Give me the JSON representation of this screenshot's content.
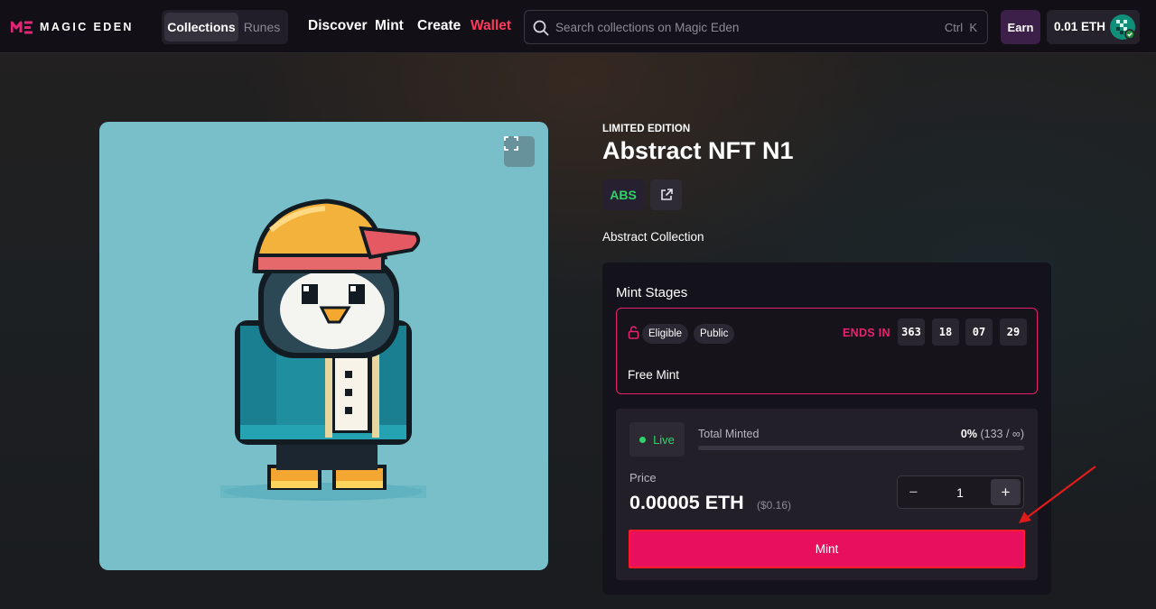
{
  "nav": {
    "logo_text": "MAGIC EDEN",
    "segments": [
      {
        "label": "Collections",
        "active": true
      },
      {
        "label": "Runes",
        "active": false
      }
    ],
    "links": [
      "Discover",
      "Mint",
      "Create",
      "Wallet"
    ],
    "search": {
      "placeholder": "Search collections on Magic Eden",
      "shortcut": "Ctrl  K"
    },
    "earn_label": "Earn",
    "balance": "0.01 ETH"
  },
  "item": {
    "edition": "LIMITED EDITION",
    "title": "Abstract NFT N1",
    "chain_tag": "ABS",
    "collection": "Abstract Collection"
  },
  "mint_stages": {
    "title": "Mint Stages",
    "stage": {
      "badges": [
        "Eligible",
        "Public"
      ],
      "ends_label": "ENDS IN",
      "countdown": [
        "363",
        "18",
        "07",
        "29"
      ],
      "name": "Free Mint"
    }
  },
  "mint": {
    "status": "Live",
    "total_label": "Total Minted",
    "percent": "0%",
    "count": "(133 / ∞)",
    "progress": 0,
    "price_label": "Price",
    "price": "0.00005 ETH",
    "price_usd": "($0.16)",
    "quantity": "1",
    "minus": "−",
    "plus": "+",
    "button_label": "Mint"
  },
  "colors": {
    "accent": "#e8105e",
    "live": "#2fd36a",
    "wallet_link": "#ff3a5c"
  }
}
